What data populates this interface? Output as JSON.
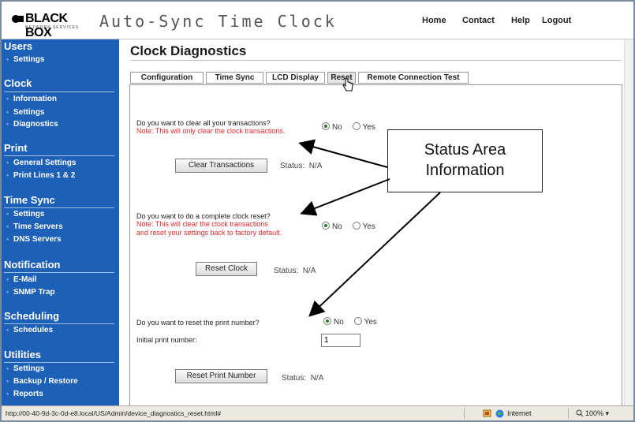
{
  "header": {
    "logo_text": "BLACK BOX",
    "logo_sub": "NETWORK SERVICES",
    "app_title": "Auto-Sync Time Clock",
    "nav": [
      "Home",
      "Contact",
      "Help",
      "Logout"
    ]
  },
  "sidebar": {
    "sections": [
      {
        "title": "Users",
        "items": [
          "Settings"
        ]
      },
      {
        "title": "Clock",
        "items": [
          "Information",
          "Settings",
          "Diagnostics"
        ]
      },
      {
        "title": "Print",
        "items": [
          "General Settings",
          "Print Lines 1 & 2"
        ]
      },
      {
        "title": "Time Sync",
        "items": [
          "Settings",
          "Time Servers",
          "DNS Servers"
        ]
      },
      {
        "title": "Notification",
        "items": [
          "E-Mail",
          "SNMP Trap"
        ]
      },
      {
        "title": "Scheduling",
        "items": [
          "Schedules"
        ]
      },
      {
        "title": "Utilities",
        "items": [
          "Settings",
          "Backup / Restore",
          "Reports"
        ]
      }
    ]
  },
  "main": {
    "title": "Clock Diagnostics",
    "tabs": [
      "Configuration",
      "Time Sync",
      "LCD Display",
      "Reset",
      "Remote Connection Test"
    ],
    "active_tab": "Reset",
    "clear": {
      "question": "Do you want to clear all your transactions?",
      "note": "Note: This will only clear the clock transactions.",
      "options": [
        "No",
        "Yes"
      ],
      "selected": "No",
      "button": "Clear Transactions",
      "status_label": "Status:",
      "status_value": "N/A"
    },
    "reset": {
      "question": "Do you want to do a complete clock reset?",
      "note_line1": "Note: This will clear the clock transactions",
      "note_line2": "and reset your settings back to factory default.",
      "options": [
        "No",
        "Yes"
      ],
      "selected": "No",
      "button": "Reset Clock",
      "status_label": "Status:",
      "status_value": "N/A"
    },
    "print": {
      "question": "Do you want to reset the print number?",
      "options": [
        "No",
        "Yes"
      ],
      "selected": "No",
      "initial_label": "Initial print number:",
      "initial_value": "1",
      "button": "Reset Print Number",
      "status_label": "Status:",
      "status_value": "N/A"
    }
  },
  "callout": {
    "line1": "Status Area",
    "line2": "Information"
  },
  "statusbar": {
    "url": "http://00-40-9d-3c-0d-e8.local/US/Admin/device_diagnostics_reset.html#",
    "zone": "Internet",
    "zoom": "100%"
  },
  "colors": {
    "sidebar": "#1d60b8",
    "note_red": "#e02828",
    "radio_selected": "#2b7a2b"
  }
}
